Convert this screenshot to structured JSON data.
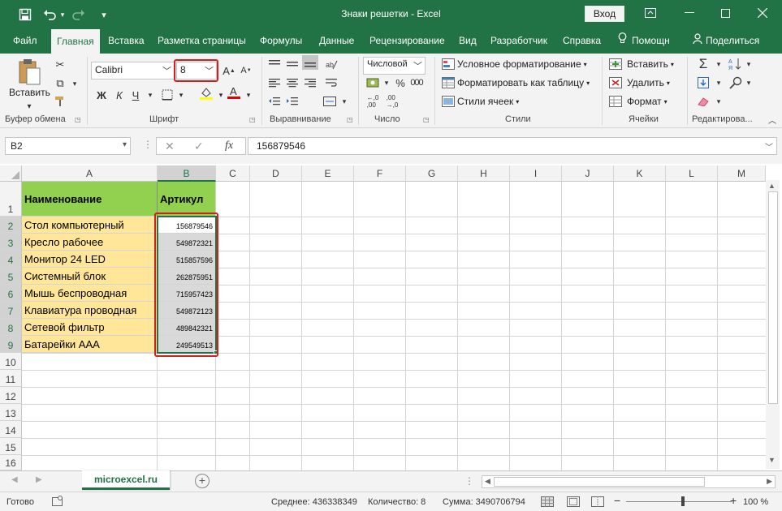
{
  "titlebar": {
    "title": "Знаки решетки  -  Excel",
    "login_label": "Вход",
    "icons": [
      "save-icon",
      "undo-icon",
      "redo-icon",
      "customize-icon",
      "ribbon-display-icon",
      "minimize-icon",
      "maximize-icon",
      "close-icon"
    ]
  },
  "tabs": [
    {
      "label": "Файл"
    },
    {
      "label": "Главная"
    },
    {
      "label": "Вставка"
    },
    {
      "label": "Разметка страницы"
    },
    {
      "label": "Формулы"
    },
    {
      "label": "Данные"
    },
    {
      "label": "Рецензирование"
    },
    {
      "label": "Вид"
    },
    {
      "label": "Разработчик"
    },
    {
      "label": "Справка"
    },
    {
      "label": "Помощн"
    },
    {
      "label": "Поделиться"
    }
  ],
  "ribbon": {
    "clipboard": {
      "paste_label": "Вставить",
      "group_label": "Буфер обмена"
    },
    "font": {
      "name": "Calibri",
      "size": "8",
      "group_label": "Шрифт",
      "bold": "Ж",
      "italic": "К",
      "underline": "Ч"
    },
    "alignment": {
      "group_label": "Выравнивание"
    },
    "number": {
      "format": "Числовой",
      "group_label": "Число"
    },
    "styles": {
      "conditional": "Условное форматирование",
      "as_table": "Форматировать как таблицу",
      "cell_styles": "Стили ячеек",
      "group_label": "Стили"
    },
    "cells": {
      "insert": "Вставить",
      "delete": "Удалить",
      "format": "Формат",
      "group_label": "Ячейки"
    },
    "editing": {
      "group_label": "Редактирова..."
    }
  },
  "formula_bar": {
    "name_box": "B2",
    "formula": "156879546",
    "fx_label": "fx"
  },
  "columns": [
    "A",
    "B",
    "C",
    "D",
    "E",
    "F",
    "G",
    "H",
    "I",
    "J",
    "K",
    "L",
    "M"
  ],
  "rows": [
    "1",
    "2",
    "3",
    "4",
    "5",
    "6",
    "7",
    "8",
    "9",
    "10",
    "11",
    "12",
    "13",
    "14",
    "15",
    "16"
  ],
  "table": {
    "header": {
      "name": "Наименование",
      "article": "Артикул"
    },
    "items": [
      {
        "name": "Стол компьютерный",
        "article": "156879546"
      },
      {
        "name": "Кресло рабочее",
        "article": "549872321"
      },
      {
        "name": "Монитор 24 LED",
        "article": "515857596"
      },
      {
        "name": "Системный блок",
        "article": "262875951"
      },
      {
        "name": "Мышь беспроводная",
        "article": "715957423"
      },
      {
        "name": "Клавиатура проводная",
        "article": "549872123"
      },
      {
        "name": "Сетевой фильтр",
        "article": "489842321"
      },
      {
        "name": "Батарейки ААА",
        "article": "249549513"
      }
    ]
  },
  "sheets": [
    {
      "label": "microexcel.ru"
    }
  ],
  "status": {
    "ready": "Готово",
    "average": "Среднее: 436338349",
    "count": "Количество: 8",
    "sum": "Сумма: 3490706794",
    "zoom": "100 %"
  },
  "colors": {
    "accent": "#217346",
    "header_fill": "#92d050",
    "name_fill": "#ffe699",
    "highlight": "#d21f1f"
  }
}
